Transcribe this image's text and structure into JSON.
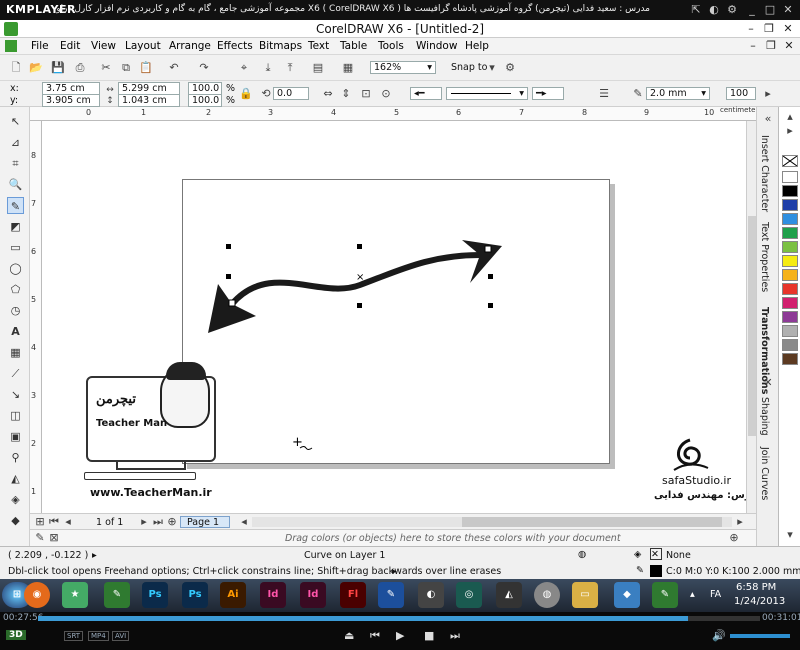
{
  "player": {
    "logo": "KMPLAYER",
    "caption": "مجموعه آموزشی جامع ، گام به گام و کاربردی نرم افزار کارل دراو X6 ( CorelDRAW X6 )   مدرس : سعید فدایی (تیچرمن) گروه آموزشی پادشاه گرافیست ها",
    "time_elapsed": "00:27:56",
    "time_total": "00:31:01",
    "progress": 0.9,
    "badges": [
      "SRT",
      "MP4",
      "AVI"
    ],
    "badge_3d": "3D"
  },
  "app": {
    "title": "CorelDRAW X6 - [Untitled-2]",
    "menu": [
      "File",
      "Edit",
      "View",
      "Layout",
      "Arrange",
      "Effects",
      "Bitmaps",
      "Text",
      "Table",
      "Tools",
      "Window",
      "Help"
    ]
  },
  "toolbar": {
    "zoom": "162%",
    "snap_to": "Snap to"
  },
  "property_bar": {
    "x": "3.75 cm",
    "y": "3.905 cm",
    "width": "5.299 cm",
    "height": "1.043 cm",
    "scale_x": "100.0",
    "scale_y": "100.0",
    "percent_sign": "%",
    "rotation": "0.0",
    "outline_width": "2.0 mm",
    "smoothing": "100"
  },
  "ruler": {
    "units": "centimeters",
    "top_ticks": [
      "0",
      "1",
      "2",
      "3",
      "4",
      "5",
      "6",
      "7",
      "8",
      "9",
      "10",
      "11"
    ],
    "left_ticks": [
      "8",
      "7",
      "6",
      "5",
      "4",
      "3",
      "2",
      "1"
    ]
  },
  "document": {
    "page_label": "Page 1",
    "page_count": "1 of 1"
  },
  "dockers": [
    "Insert Character",
    "Text Properties",
    "Transformations",
    "Shaping",
    "Join Curves"
  ],
  "palette": [
    "#ffffff",
    "#000000",
    "#1e3ea8",
    "#2f8fe0",
    "#1fa04a",
    "#7bc143",
    "#f6ec12",
    "#f5b21a",
    "#e7352b",
    "#d1206f",
    "#8d3a96",
    "#b0b0b0",
    "#8a8a8a",
    "#5c3a21"
  ],
  "status": {
    "coords": "( 2.209 , -0.122 )",
    "object": "Curve on Layer 1",
    "hint": "Dbl-click tool opens Freehand options; Ctrl+click constrains line; Shift+drag backwards over line erases",
    "drop_hint": "Drag colors (or objects) here to store these colors with your document",
    "fill": "None",
    "outline": "C:0 M:0 Y:0 K:100  2.000 mm"
  },
  "taskbar": {
    "apps": [
      "Ps",
      "Ps",
      "Ai",
      "Id",
      "Id",
      "Fl"
    ],
    "time": "6:58 PM",
    "date": "1/24/2013",
    "lang": "FA"
  },
  "watermarks": {
    "teacherman": "www.TeacherMan.ir",
    "teacherman_logo": "Teacher Man",
    "teacherman_fa": "تیچرمن",
    "safa": "safaStudio.ir",
    "safa_fa": "مدرس: مهندس فدایی"
  }
}
